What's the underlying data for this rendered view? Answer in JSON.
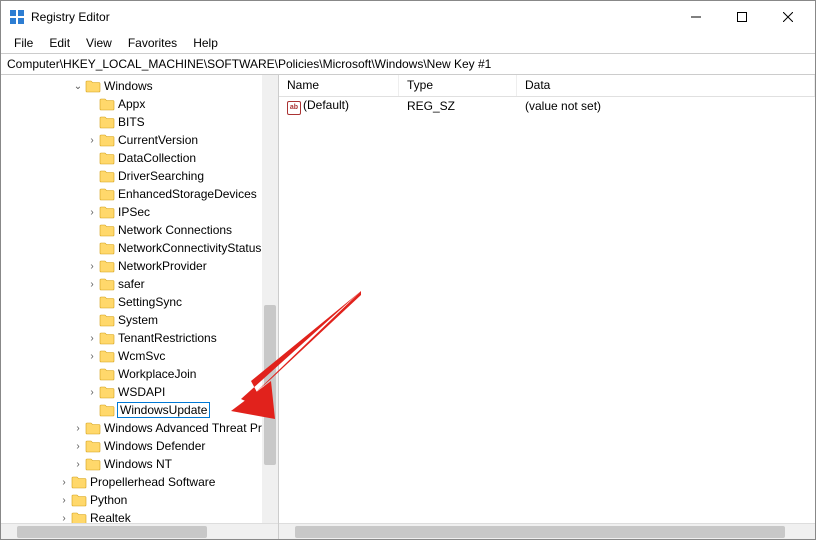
{
  "window": {
    "title": "Registry Editor"
  },
  "menu": {
    "file": "File",
    "edit": "Edit",
    "view": "View",
    "favorites": "Favorites",
    "help": "Help"
  },
  "address": {
    "path": "Computer\\HKEY_LOCAL_MACHINE\\SOFTWARE\\Policies\\Microsoft\\Windows\\New Key #1"
  },
  "tree": {
    "items": [
      {
        "indent": 5,
        "arrow": "down",
        "label": "Windows",
        "editing": false
      },
      {
        "indent": 6,
        "arrow": "",
        "label": "Appx"
      },
      {
        "indent": 6,
        "arrow": "",
        "label": "BITS"
      },
      {
        "indent": 6,
        "arrow": "right",
        "label": "CurrentVersion"
      },
      {
        "indent": 6,
        "arrow": "",
        "label": "DataCollection"
      },
      {
        "indent": 6,
        "arrow": "",
        "label": "DriverSearching"
      },
      {
        "indent": 6,
        "arrow": "",
        "label": "EnhancedStorageDevices"
      },
      {
        "indent": 6,
        "arrow": "right",
        "label": "IPSec"
      },
      {
        "indent": 6,
        "arrow": "",
        "label": "Network Connections"
      },
      {
        "indent": 6,
        "arrow": "",
        "label": "NetworkConnectivityStatusIndicator"
      },
      {
        "indent": 6,
        "arrow": "right",
        "label": "NetworkProvider"
      },
      {
        "indent": 6,
        "arrow": "right",
        "label": "safer"
      },
      {
        "indent": 6,
        "arrow": "",
        "label": "SettingSync"
      },
      {
        "indent": 6,
        "arrow": "",
        "label": "System"
      },
      {
        "indent": 6,
        "arrow": "right",
        "label": "TenantRestrictions"
      },
      {
        "indent": 6,
        "arrow": "right",
        "label": "WcmSvc"
      },
      {
        "indent": 6,
        "arrow": "",
        "label": "WorkplaceJoin"
      },
      {
        "indent": 6,
        "arrow": "right",
        "label": "WSDAPI"
      },
      {
        "indent": 6,
        "arrow": "",
        "label": "WindowsUpdate",
        "editing": true
      },
      {
        "indent": 5,
        "arrow": "right",
        "label": "Windows Advanced Threat Protection"
      },
      {
        "indent": 5,
        "arrow": "right",
        "label": "Windows Defender"
      },
      {
        "indent": 5,
        "arrow": "right",
        "label": "Windows NT"
      },
      {
        "indent": 4,
        "arrow": "right",
        "label": "Propellerhead Software"
      },
      {
        "indent": 4,
        "arrow": "right",
        "label": "Python"
      },
      {
        "indent": 4,
        "arrow": "right",
        "label": "Realtek"
      }
    ]
  },
  "list": {
    "headers": {
      "name": "Name",
      "type": "Type",
      "data": "Data"
    },
    "rows": [
      {
        "name": "(Default)",
        "type": "REG_SZ",
        "data": "(value not set)"
      }
    ]
  }
}
